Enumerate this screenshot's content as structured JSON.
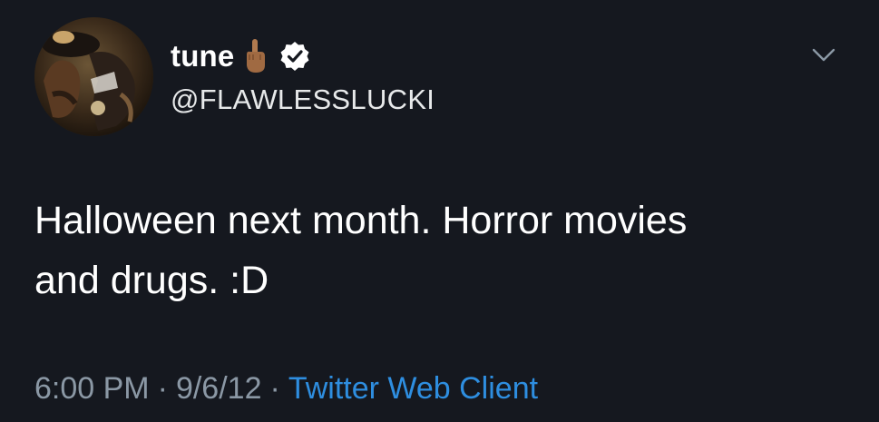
{
  "user": {
    "display_name": "tune",
    "name_emoji": "🖕🏽",
    "handle": "@FLAWLESSLUCKI",
    "verified": true,
    "avatar_icon": "avatar-photo"
  },
  "tweet": {
    "lines": [
      "Halloween next month. Horror movies",
      "and drugs. :D"
    ]
  },
  "meta": {
    "time": "6:00 PM",
    "separator": "·",
    "date": "9/6/12",
    "source": "Twitter Web Client"
  },
  "colors": {
    "background": "#15181f",
    "primary_text": "#ffffff",
    "secondary_text": "#8b98a5",
    "link": "#2e8ee0",
    "verified_badge": "#ffffff"
  },
  "icons": {
    "menu": "chevron-down-icon",
    "verified": "verified-badge-icon"
  }
}
